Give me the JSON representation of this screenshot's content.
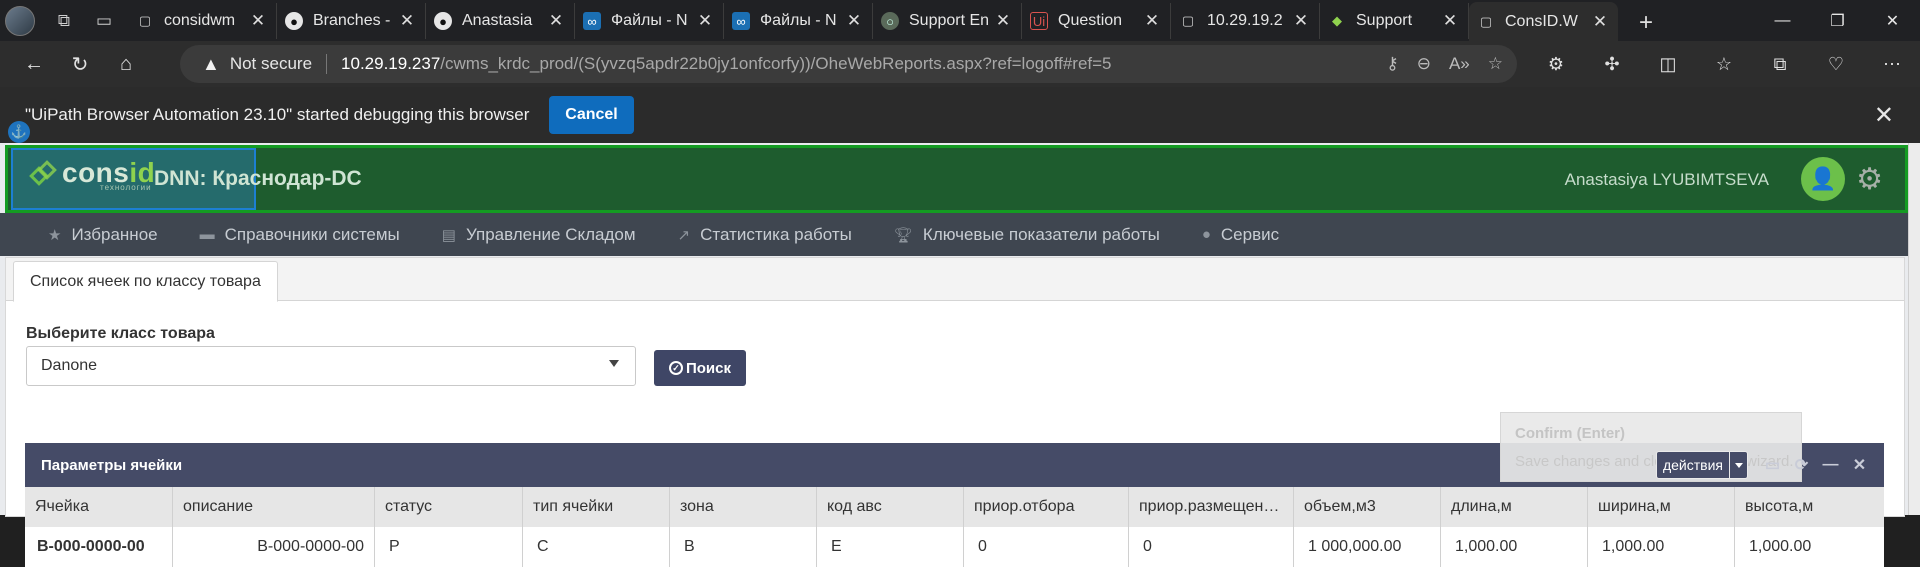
{
  "browser": {
    "tools_left": [
      "workspaces-icon",
      "tab-actions-icon"
    ],
    "tabs": [
      {
        "title": "considwm",
        "icon": "page-icon",
        "active": false
      },
      {
        "title": "Branches -",
        "icon": "github-icon",
        "active": false
      },
      {
        "title": "Anastasia",
        "icon": "github-icon",
        "active": false
      },
      {
        "title": "Файлы - N",
        "icon": "nextcloud-icon",
        "active": false
      },
      {
        "title": "Файлы - N",
        "icon": "nextcloud-icon",
        "active": false
      },
      {
        "title": "Support En",
        "icon": "support-icon",
        "active": false
      },
      {
        "title": "Question",
        "icon": "uipath-icon",
        "active": false
      },
      {
        "title": "10.29.19.2",
        "icon": "page-icon",
        "active": false
      },
      {
        "title": "Support",
        "icon": "support-icon",
        "active": false
      },
      {
        "title": "ConsID.W",
        "icon": "page-icon",
        "active": true
      }
    ],
    "address": {
      "security_label": "Not secure",
      "host": "10.29.19.237",
      "path": "/cwms_krdc_prod/(S(yvzq5apdr22b0jy1onfcorfy))/OheWebReports.aspx?ref=logoff#ref=5"
    },
    "infobar": {
      "message": "\"UiPath Browser Automation 23.10\" started debugging this browser",
      "cancel_label": "Cancel"
    }
  },
  "app": {
    "logo_word_main": "cons",
    "logo_word_accent": "id",
    "logo_sub": "технологии",
    "site_title": "DNN: Краснодар-DC",
    "user_name": "Anastasiya LYUBIMTSEVA",
    "menu": [
      {
        "label": "Избранное",
        "icon": "star-icon"
      },
      {
        "label": "Справочники системы",
        "icon": "archive-icon"
      },
      {
        "label": "Управление Складом",
        "icon": "warehouse-icon"
      },
      {
        "label": "Статистика работы",
        "icon": "chart-icon"
      },
      {
        "label": "Ключевые показатели работы",
        "icon": "trophy-icon"
      },
      {
        "label": "Сервис",
        "icon": "info-icon"
      }
    ],
    "page_tab": "Список ячеек по классу товара",
    "form": {
      "label": "Выберите класс товара",
      "selected": "Danone",
      "search_label": "Поиск"
    },
    "confirm": {
      "title": "Confirm (Enter)",
      "message": "Save changes and close selection wizard."
    },
    "panel": {
      "title": "Параметры ячейки",
      "actions_label": "действия"
    },
    "grid": {
      "columns": [
        "Ячейка",
        "описание",
        "статус",
        "тип ячейки",
        "зона",
        "код авс",
        "приор.отбора",
        "приор.размещен…",
        "объем,м3",
        "длина,м",
        "ширина,м",
        "высота,м"
      ],
      "rows": [
        [
          "B-000-0000-00",
          "B-000-0000-00",
          "P",
          "C",
          "B",
          "E",
          "0",
          "0",
          "1 000,000.00",
          "1,000.00",
          "1,000.00",
          "1,000.00"
        ]
      ]
    }
  }
}
